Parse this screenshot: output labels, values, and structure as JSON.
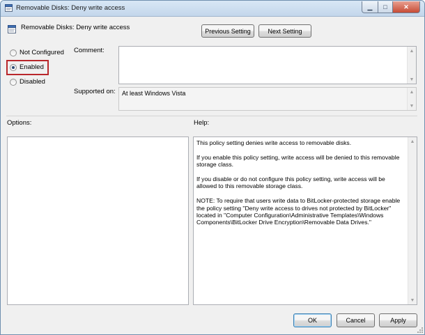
{
  "window": {
    "title": "Removable Disks: Deny write access"
  },
  "header": {
    "policy_name": "Removable Disks: Deny write access"
  },
  "nav": {
    "previous": "Previous Setting",
    "next": "Next Setting"
  },
  "state": {
    "options": [
      {
        "label": "Not Configured",
        "checked": false
      },
      {
        "label": "Enabled",
        "checked": true
      },
      {
        "label": "Disabled",
        "checked": false
      }
    ]
  },
  "comment": {
    "label": "Comment:",
    "value": ""
  },
  "supported": {
    "label": "Supported on:",
    "value": "At least Windows Vista"
  },
  "options_panel": {
    "label": "Options:"
  },
  "help": {
    "label": "Help:",
    "paragraphs": [
      "This policy setting denies write access to removable disks.",
      "If you enable this policy setting, write access will be denied to this removable storage class.",
      "If you disable or do not configure this policy setting, write access will be allowed to this removable storage class.",
      "NOTE: To require that users write data to BitLocker-protected storage enable the policy setting \"Deny write access to drives not protected by BitLocker\" located in \"Computer Configuration\\Administrative Templates\\Windows Components\\BitLocker Drive Encryption\\Removable Data Drives.\""
    ]
  },
  "footer": {
    "ok": "OK",
    "cancel": "Cancel",
    "apply": "Apply"
  },
  "icons": {
    "window": "policy-icon",
    "minimize": "minimize-icon",
    "maximize": "maximize-icon",
    "close": "close-icon"
  },
  "colors": {
    "highlight_border": "#b9272b",
    "default_button_border": "#3c7fb1"
  }
}
